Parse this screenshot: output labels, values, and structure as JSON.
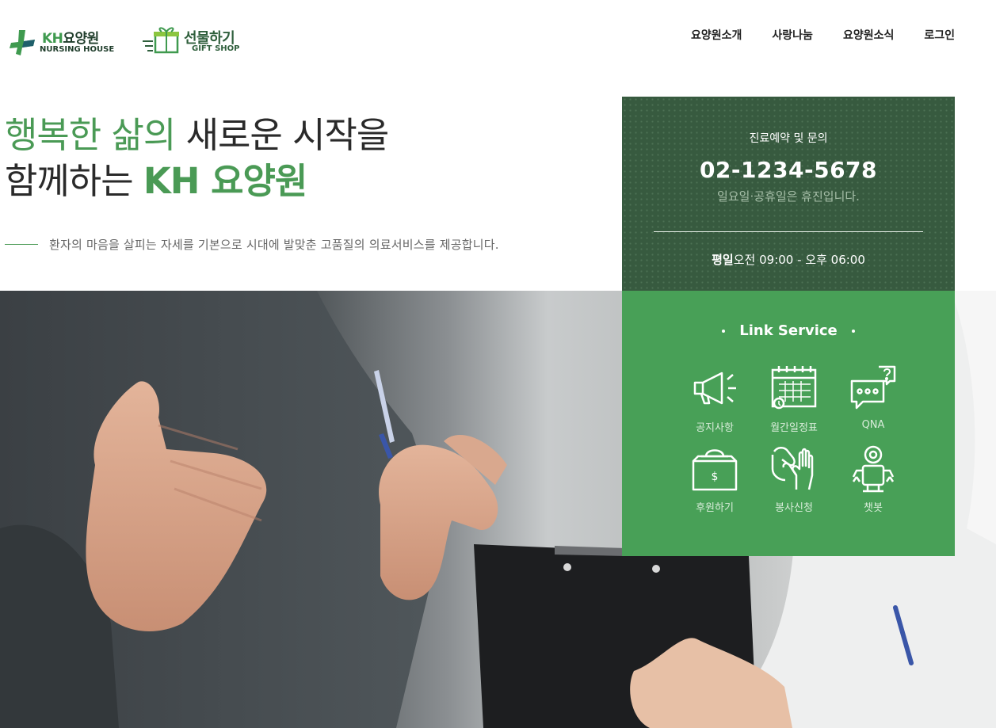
{
  "header": {
    "logo": {
      "brand_prefix": "KH",
      "brand_name": "요양원",
      "subtitle": "NURSING HOUSE"
    },
    "gift_logo": {
      "name": "선물하기",
      "subtitle": "GIFT SHOP"
    },
    "nav": [
      {
        "label": "요양원소개"
      },
      {
        "label": "사랑나눔"
      },
      {
        "label": "요양원소식"
      },
      {
        "label": "로그인"
      }
    ]
  },
  "hero": {
    "line1_green": "행복한 삶의",
    "line1_dark": " 새로운 시작을",
    "line2_dark": "함께하는 ",
    "line2_bold": "KH 요양원",
    "tagline": "환자의 마음을 살피는 자세를 기본으로 시대에 발맞춘 고품질의 의료서비스를 제공합니다."
  },
  "contact": {
    "label": "진료예약 및 문의",
    "phone": "02-1234-5678",
    "note": "일요일·공휴일은 휴진입니다.",
    "hours_day": "평일",
    "hours_time": "오전 09:00 - 오후 06:00"
  },
  "link_service": {
    "title": "Link Service",
    "items": [
      {
        "label": "공지사항",
        "icon": "megaphone-icon"
      },
      {
        "label": "월간일정표",
        "icon": "calendar-icon"
      },
      {
        "label": "QNA",
        "icon": "chat-question-icon"
      },
      {
        "label": "후원하기",
        "icon": "donation-box-icon"
      },
      {
        "label": "봉사신청",
        "icon": "helping-hands-icon"
      },
      {
        "label": "챗봇",
        "icon": "robot-icon"
      }
    ]
  },
  "colors": {
    "brand_green": "#4a9a55",
    "dark_green_panel": "#375a3f",
    "link_panel_green": "#48a057"
  }
}
